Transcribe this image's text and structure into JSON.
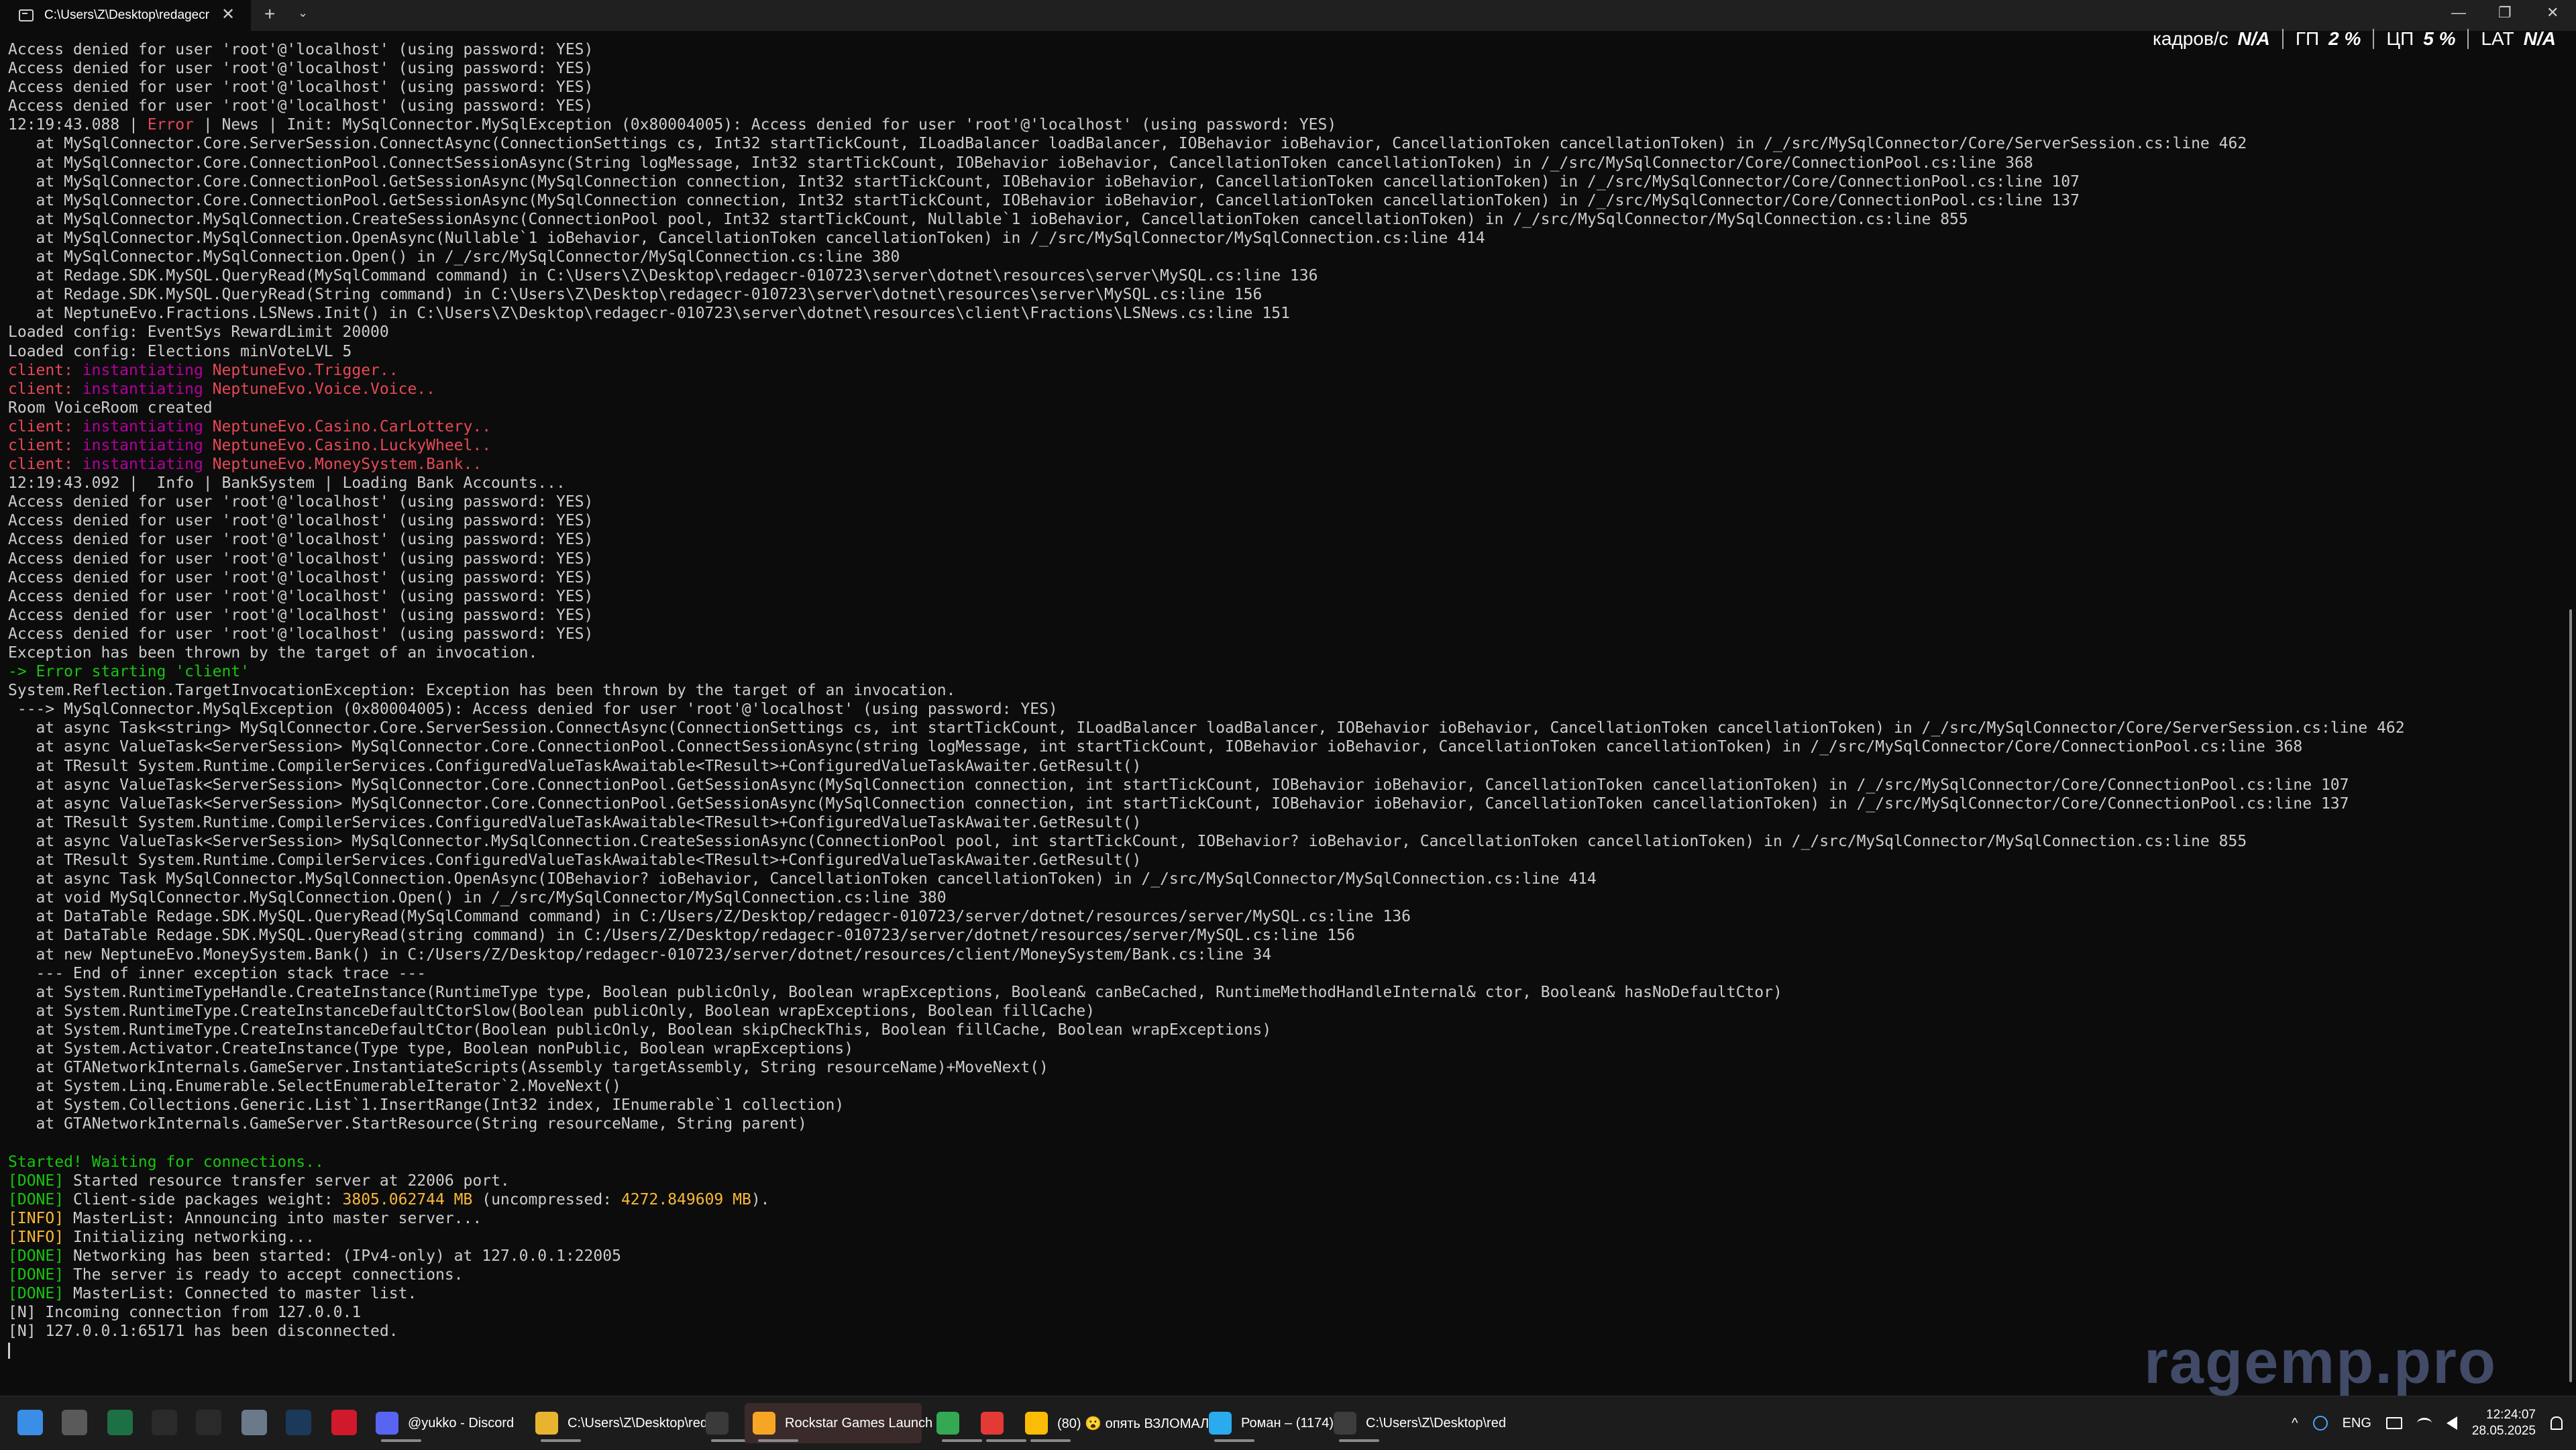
{
  "window": {
    "tab_title": "C:\\Users\\Z\\Desktop\\redagecr",
    "close_glyph": "✕",
    "new_tab_glyph": "+",
    "dropdown_glyph": "⌄",
    "minimize_glyph": "—",
    "maximize_glyph": "❐",
    "window_close_glyph": "✕"
  },
  "overlay": {
    "fps_label": "кадров/с",
    "fps_value": "N/A",
    "gpu_label": "ГП",
    "gpu_value": "2 %",
    "cpu_label": "ЦП",
    "cpu_value": "5 %",
    "lat_label": "LAT",
    "lat_value": "N/A"
  },
  "console": {
    "lines": [
      [
        {
          "t": "Access denied for user 'root'@'localhost' (using password: YES)"
        }
      ],
      [
        {
          "t": "Access denied for user 'root'@'localhost' (using password: YES)"
        }
      ],
      [
        {
          "t": "Access denied for user 'root'@'localhost' (using password: YES)"
        }
      ],
      [
        {
          "t": "Access denied for user 'root'@'localhost' (using password: YES)"
        }
      ],
      [
        {
          "t": "12:19:43.088 | "
        },
        {
          "t": "Error",
          "c": "red"
        },
        {
          "t": " | News | Init: MySqlConnector.MySqlException (0x80004005): Access denied for user 'root'@'localhost' (using password: YES)"
        }
      ],
      [
        {
          "t": "   at MySqlConnector.Core.ServerSession.ConnectAsync(ConnectionSettings cs, Int32 startTickCount, ILoadBalancer loadBalancer, IOBehavior ioBehavior, CancellationToken cancellationToken) in /_/src/MySqlConnector/Core/ServerSession.cs:line 462"
        }
      ],
      [
        {
          "t": "   at MySqlConnector.Core.ConnectionPool.ConnectSessionAsync(String logMessage, Int32 startTickCount, IOBehavior ioBehavior, CancellationToken cancellationToken) in /_/src/MySqlConnector/Core/ConnectionPool.cs:line 368"
        }
      ],
      [
        {
          "t": "   at MySqlConnector.Core.ConnectionPool.GetSessionAsync(MySqlConnection connection, Int32 startTickCount, IOBehavior ioBehavior, CancellationToken cancellationToken) in /_/src/MySqlConnector/Core/ConnectionPool.cs:line 107"
        }
      ],
      [
        {
          "t": "   at MySqlConnector.Core.ConnectionPool.GetSessionAsync(MySqlConnection connection, Int32 startTickCount, IOBehavior ioBehavior, CancellationToken cancellationToken) in /_/src/MySqlConnector/Core/ConnectionPool.cs:line 137"
        }
      ],
      [
        {
          "t": "   at MySqlConnector.MySqlConnection.CreateSessionAsync(ConnectionPool pool, Int32 startTickCount, Nullable`1 ioBehavior, CancellationToken cancellationToken) in /_/src/MySqlConnector/MySqlConnection.cs:line 855"
        }
      ],
      [
        {
          "t": "   at MySqlConnector.MySqlConnection.OpenAsync(Nullable`1 ioBehavior, CancellationToken cancellationToken) in /_/src/MySqlConnector/MySqlConnection.cs:line 414"
        }
      ],
      [
        {
          "t": "   at MySqlConnector.MySqlConnection.Open() in /_/src/MySqlConnector/MySqlConnection.cs:line 380"
        }
      ],
      [
        {
          "t": "   at Redage.SDK.MySQL.QueryRead(MySqlCommand command) in C:\\Users\\Z\\Desktop\\redagecr-010723\\server\\dotnet\\resources\\server\\MySQL.cs:line 136"
        }
      ],
      [
        {
          "t": "   at Redage.SDK.MySQL.QueryRead(String command) in C:\\Users\\Z\\Desktop\\redagecr-010723\\server\\dotnet\\resources\\server\\MySQL.cs:line 156"
        }
      ],
      [
        {
          "t": "   at NeptuneEvo.Fractions.LSNews.Init() in C:\\Users\\Z\\Desktop\\redagecr-010723\\server\\dotnet\\resources\\client\\Fractions\\LSNews.cs:line 151"
        }
      ],
      [
        {
          "t": "Loaded config: EventSys RewardLimit 20000"
        }
      ],
      [
        {
          "t": "Loaded config: Elections minVoteLVL 5"
        }
      ],
      [
        {
          "t": "client: ",
          "c": "red"
        },
        {
          "t": "instantiating ",
          "c": "mag"
        },
        {
          "t": "NeptuneEvo.Trigger..",
          "c": "red"
        }
      ],
      [
        {
          "t": "client: ",
          "c": "red"
        },
        {
          "t": "instantiating ",
          "c": "mag"
        },
        {
          "t": "NeptuneEvo.Voice.Voice..",
          "c": "red"
        }
      ],
      [
        {
          "t": "Room VoiceRoom created"
        }
      ],
      [
        {
          "t": "client: ",
          "c": "red"
        },
        {
          "t": "instantiating ",
          "c": "mag"
        },
        {
          "t": "NeptuneEvo.Casino.CarLottery..",
          "c": "red"
        }
      ],
      [
        {
          "t": "client: ",
          "c": "red"
        },
        {
          "t": "instantiating ",
          "c": "mag"
        },
        {
          "t": "NeptuneEvo.Casino.LuckyWheel..",
          "c": "red"
        }
      ],
      [
        {
          "t": "client: ",
          "c": "red"
        },
        {
          "t": "instantiating ",
          "c": "mag"
        },
        {
          "t": "NeptuneEvo.MoneySystem.Bank..",
          "c": "red"
        }
      ],
      [
        {
          "t": "12:19:43.092 |  Info | BankSystem | Loading Bank Accounts..."
        }
      ],
      [
        {
          "t": "Access denied for user 'root'@'localhost' (using password: YES)"
        }
      ],
      [
        {
          "t": "Access denied for user 'root'@'localhost' (using password: YES)"
        }
      ],
      [
        {
          "t": "Access denied for user 'root'@'localhost' (using password: YES)"
        }
      ],
      [
        {
          "t": "Access denied for user 'root'@'localhost' (using password: YES)"
        }
      ],
      [
        {
          "t": "Access denied for user 'root'@'localhost' (using password: YES)"
        }
      ],
      [
        {
          "t": "Access denied for user 'root'@'localhost' (using password: YES)"
        }
      ],
      [
        {
          "t": "Access denied for user 'root'@'localhost' (using password: YES)"
        }
      ],
      [
        {
          "t": "Access denied for user 'root'@'localhost' (using password: YES)"
        }
      ],
      [
        {
          "t": "Exception has been thrown by the target of an invocation."
        }
      ],
      [
        {
          "t": "-> Error starting 'client'",
          "c": "grn"
        }
      ],
      [
        {
          "t": "System.Reflection.TargetInvocationException: Exception has been thrown by the target of an invocation."
        }
      ],
      [
        {
          "t": " ---> MySqlConnector.MySqlException (0x80004005): Access denied for user 'root'@'localhost' (using password: YES)"
        }
      ],
      [
        {
          "t": "   at async Task<string> MySqlConnector.Core.ServerSession.ConnectAsync(ConnectionSettings cs, int startTickCount, ILoadBalancer loadBalancer, IOBehavior ioBehavior, CancellationToken cancellationToken) in /_/src/MySqlConnector/Core/ServerSession.cs:line 462"
        }
      ],
      [
        {
          "t": "   at async ValueTask<ServerSession> MySqlConnector.Core.ConnectionPool.ConnectSessionAsync(string logMessage, int startTickCount, IOBehavior ioBehavior, CancellationToken cancellationToken) in /_/src/MySqlConnector/Core/ConnectionPool.cs:line 368"
        }
      ],
      [
        {
          "t": "   at TResult System.Runtime.CompilerServices.ConfiguredValueTaskAwaitable<TResult>+ConfiguredValueTaskAwaiter.GetResult()"
        }
      ],
      [
        {
          "t": "   at async ValueTask<ServerSession> MySqlConnector.Core.ConnectionPool.GetSessionAsync(MySqlConnection connection, int startTickCount, IOBehavior ioBehavior, CancellationToken cancellationToken) in /_/src/MySqlConnector/Core/ConnectionPool.cs:line 107"
        }
      ],
      [
        {
          "t": "   at async ValueTask<ServerSession> MySqlConnector.Core.ConnectionPool.GetSessionAsync(MySqlConnection connection, int startTickCount, IOBehavior ioBehavior, CancellationToken cancellationToken) in /_/src/MySqlConnector/Core/ConnectionPool.cs:line 137"
        }
      ],
      [
        {
          "t": "   at TResult System.Runtime.CompilerServices.ConfiguredValueTaskAwaitable<TResult>+ConfiguredValueTaskAwaiter.GetResult()"
        }
      ],
      [
        {
          "t": "   at async ValueTask<ServerSession> MySqlConnector.MySqlConnection.CreateSessionAsync(ConnectionPool pool, int startTickCount, IOBehavior? ioBehavior, CancellationToken cancellationToken) in /_/src/MySqlConnector/MySqlConnection.cs:line 855"
        }
      ],
      [
        {
          "t": "   at TResult System.Runtime.CompilerServices.ConfiguredValueTaskAwaitable<TResult>+ConfiguredValueTaskAwaiter.GetResult()"
        }
      ],
      [
        {
          "t": "   at async Task MySqlConnector.MySqlConnection.OpenAsync(IOBehavior? ioBehavior, CancellationToken cancellationToken) in /_/src/MySqlConnector/MySqlConnection.cs:line 414"
        }
      ],
      [
        {
          "t": "   at void MySqlConnector.MySqlConnection.Open() in /_/src/MySqlConnector/MySqlConnection.cs:line 380"
        }
      ],
      [
        {
          "t": "   at DataTable Redage.SDK.MySQL.QueryRead(MySqlCommand command) in C:/Users/Z/Desktop/redagecr-010723/server/dotnet/resources/server/MySQL.cs:line 136"
        }
      ],
      [
        {
          "t": "   at DataTable Redage.SDK.MySQL.QueryRead(string command) in C:/Users/Z/Desktop/redagecr-010723/server/dotnet/resources/server/MySQL.cs:line 156"
        }
      ],
      [
        {
          "t": "   at new NeptuneEvo.MoneySystem.Bank() in C:/Users/Z/Desktop/redagecr-010723/server/dotnet/resources/client/MoneySystem/Bank.cs:line 34"
        }
      ],
      [
        {
          "t": "   --- End of inner exception stack trace ---"
        }
      ],
      [
        {
          "t": "   at System.RuntimeTypeHandle.CreateInstance(RuntimeType type, Boolean publicOnly, Boolean wrapExceptions, Boolean& canBeCached, RuntimeMethodHandleInternal& ctor, Boolean& hasNoDefaultCtor)"
        }
      ],
      [
        {
          "t": "   at System.RuntimeType.CreateInstanceDefaultCtorSlow(Boolean publicOnly, Boolean wrapExceptions, Boolean fillCache)"
        }
      ],
      [
        {
          "t": "   at System.RuntimeType.CreateInstanceDefaultCtor(Boolean publicOnly, Boolean skipCheckThis, Boolean fillCache, Boolean wrapExceptions)"
        }
      ],
      [
        {
          "t": "   at System.Activator.CreateInstance(Type type, Boolean nonPublic, Boolean wrapExceptions)"
        }
      ],
      [
        {
          "t": "   at GTANetworkInternals.GameServer.InstantiateScripts(Assembly targetAssembly, String resourceName)+MoveNext()"
        }
      ],
      [
        {
          "t": "   at System.Linq.Enumerable.SelectEnumerableIterator`2.MoveNext()"
        }
      ],
      [
        {
          "t": "   at System.Collections.Generic.List`1.InsertRange(Int32 index, IEnumerable`1 collection)"
        }
      ],
      [
        {
          "t": "   at GTANetworkInternals.GameServer.StartResource(String resourceName, String parent)"
        }
      ],
      [
        {
          "t": " "
        }
      ],
      [
        {
          "t": "Started! Waiting for connections..",
          "c": "grn"
        }
      ],
      [
        {
          "t": "[DONE]",
          "c": "grn"
        },
        {
          "t": " Started resource transfer server at 22006 port."
        }
      ],
      [
        {
          "t": "[DONE]",
          "c": "grn"
        },
        {
          "t": " Client-side packages weight: "
        },
        {
          "t": "3805.062744 MB",
          "c": "yel"
        },
        {
          "t": " (uncompressed: "
        },
        {
          "t": "4272.849609 MB",
          "c": "yel"
        },
        {
          "t": ")."
        }
      ],
      [
        {
          "t": "[INFO]",
          "c": "yel"
        },
        {
          "t": " MasterList: Announcing into master server..."
        }
      ],
      [
        {
          "t": "[INFO]",
          "c": "yel"
        },
        {
          "t": " Initializing networking..."
        }
      ],
      [
        {
          "t": "[DONE]",
          "c": "grn"
        },
        {
          "t": " Networking has been started: (IPv4-only) at 127.0.0.1:22005"
        }
      ],
      [
        {
          "t": "[DONE]",
          "c": "grn"
        },
        {
          "t": " The server is ready to accept connections."
        }
      ],
      [
        {
          "t": "[DONE]",
          "c": "grn"
        },
        {
          "t": " MasterList: Connected to master list."
        }
      ],
      [
        {
          "t": "[N] Incoming connection from 127.0.0.1"
        }
      ],
      [
        {
          "t": "[N] 127.0.0.1:65171 has been disconnected."
        }
      ]
    ]
  },
  "watermark": "ragemp.pro",
  "taskbar": {
    "icons": [
      {
        "name": "start-icon",
        "color": "#3a8ee6"
      },
      {
        "name": "task-view-icon",
        "color": "#5a5a5a"
      },
      {
        "name": "excel-icon",
        "color": "#1d7044"
      },
      {
        "name": "rockstar-r-icon",
        "color": "#2a2a2a"
      },
      {
        "name": "media-player-icon",
        "color": "#2a2a2a"
      },
      {
        "name": "settings-icon",
        "color": "#6b7a8a"
      },
      {
        "name": "steam-icon",
        "color": "#1b3a5a"
      },
      {
        "name": "opera-icon",
        "color": "#d0192a"
      }
    ],
    "apps": [
      {
        "name": "discord-icon",
        "color": "#5865f2",
        "label": "@yukko - Discord"
      },
      {
        "name": "folder-icon",
        "color": "#e8b430",
        "label": "C:\\Users\\Z\\Desktop\\red"
      },
      {
        "name": "rage-icon",
        "color": "#3a3a3a",
        "label": ""
      },
      {
        "name": "rockstar-launcher-icon",
        "color": "#f6a623",
        "label": "Rockstar Games Launch"
      },
      {
        "name": "chrome-icon",
        "color": "#34a853",
        "label": ""
      },
      {
        "name": "yandex-icon",
        "color": "#e53935",
        "label": ""
      },
      {
        "name": "chrome-profile-icon",
        "color": "#fbbc05",
        "label": "(80) 😮 опять ВЗЛОМАЛ"
      },
      {
        "name": "telegram-icon",
        "color": "#2aabee",
        "label": "Роман – (1174)"
      },
      {
        "name": "terminal-icon",
        "color": "#3c3c3c",
        "label": "C:\\Users\\Z\\Desktop\\red"
      }
    ],
    "tray": {
      "chevron": "^",
      "lang": "ENG",
      "time": "12:24:07",
      "date": "28.05.2025"
    }
  }
}
